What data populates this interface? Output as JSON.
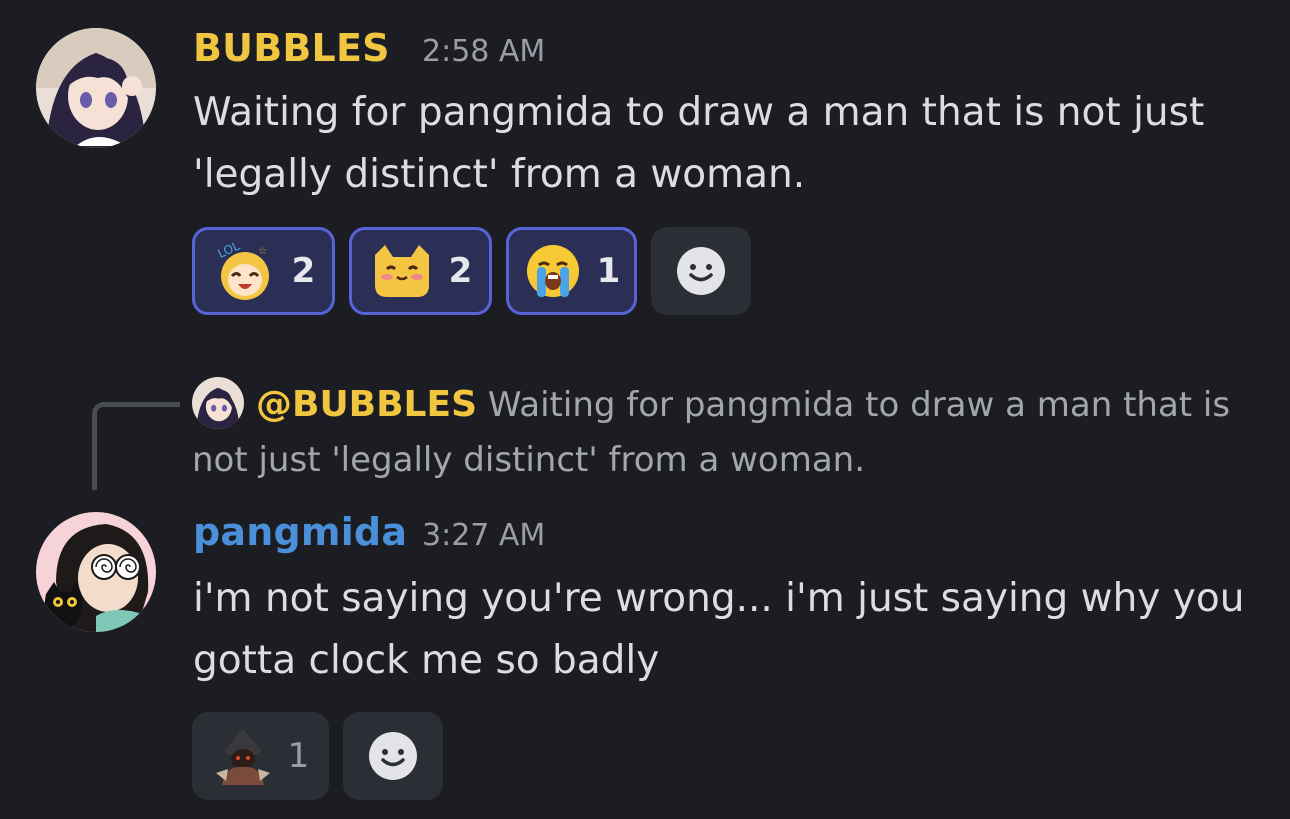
{
  "messages": [
    {
      "author": "BUBBLES",
      "author_color": "#f0c540",
      "timestamp": "2:58 AM",
      "text": "Waiting for pangmida to draw a man that is not just 'legally distinct' from a woman.",
      "avatar": "anime-girl-avatar",
      "reactions": [
        {
          "emoji": "lol-anime-girl-emoji",
          "count": "2",
          "active": true
        },
        {
          "emoji": "blushing-cat-emoji",
          "count": "2",
          "active": true
        },
        {
          "emoji": "loudly-crying-face-emoji",
          "count": "1",
          "active": true
        }
      ]
    },
    {
      "reply_to": {
        "mention": "@BUBBLES",
        "text": "Waiting for pangmida to draw a man that is not just 'legally distinct' from a woman."
      },
      "author": "pangmida",
      "author_color": "#4a8fd9",
      "timestamp": "3:27 AM",
      "text": "i'm not saying you're wrong... i'm just saying why you gotta clock me so badly",
      "avatar": "spiral-eyes-cat-avatar",
      "reactions": [
        {
          "emoji": "hooded-figure-emoji",
          "count": "1",
          "active": false
        }
      ]
    }
  ],
  "icons": {
    "add_reaction": "smiley-add-reaction-icon"
  },
  "colors": {
    "background": "#1c1d22",
    "accent": "#5864d6",
    "reaction_active_bg": "#2b2f55"
  }
}
